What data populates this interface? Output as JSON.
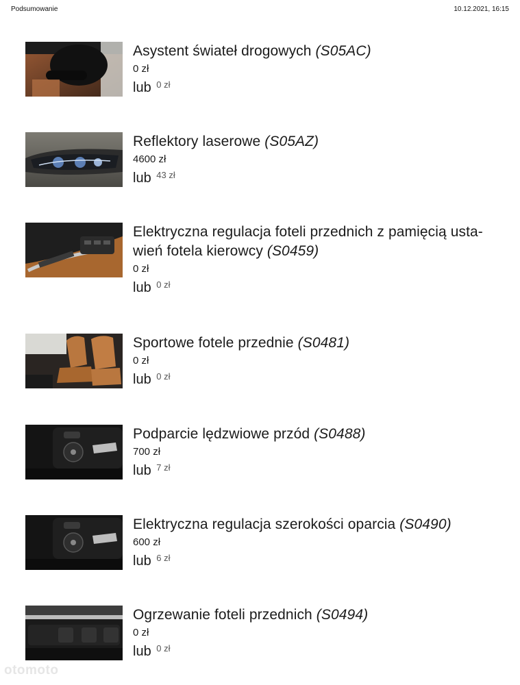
{
  "header": {
    "title": "Podsumowanie",
    "datetime": "10.12.2021, 16:15"
  },
  "items": [
    {
      "name": "Asystent świateł drogowych",
      "code": "(S05AC)",
      "price": "0 zł",
      "alt_label": "lub",
      "alt_price": "0 zł",
      "image": "interior-mirror-photo"
    },
    {
      "name": "Reflektory laserowe",
      "code": "(S05AZ)",
      "price": "4600 zł",
      "alt_label": "lub",
      "alt_price": "43 zł",
      "image": "laser-headlight-photo"
    },
    {
      "name": "Elektryczna regulacja foteli przednich z pamięcią usta-",
      "name_line2": "wień fotela kierowcy",
      "code": "(S0459)",
      "price": "0 zł",
      "alt_label": "lub",
      "alt_price": "0 zł",
      "image": "door-panel-memory-buttons-photo"
    },
    {
      "name": "Sportowe fotele przednie",
      "code": "(S0481)",
      "price": "0 zł",
      "alt_label": "lub",
      "alt_price": "0 zł",
      "image": "sport-seats-photo"
    },
    {
      "name": "Podparcie lędzwiowe przód",
      "code": "(S0488)",
      "price": "700 zł",
      "alt_label": "lub",
      "alt_price": "7 zł",
      "image": "seat-controls-photo"
    },
    {
      "name": "Elektryczna regulacja szerokości oparcia",
      "code": "(S0490)",
      "price": "600 zł",
      "alt_label": "lub",
      "alt_price": "6 zł",
      "image": "seat-controls-photo"
    },
    {
      "name": "Ogrzewanie foteli przednich",
      "code": "(S0494)",
      "price": "0 zł",
      "alt_label": "lub",
      "alt_price": "0 zł",
      "image": "seat-heating-buttons-photo"
    }
  ],
  "watermark": "otomoto"
}
